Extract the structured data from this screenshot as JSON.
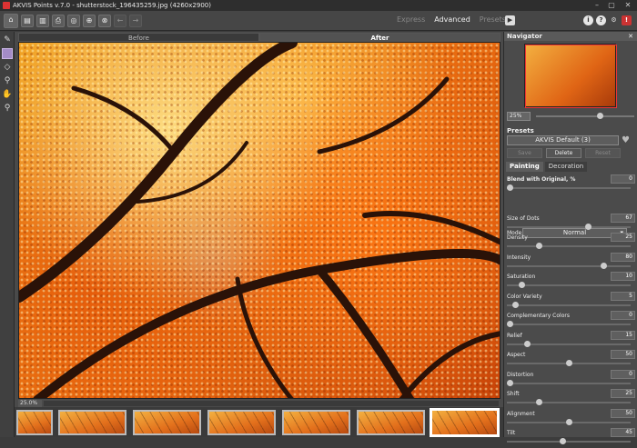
{
  "window": {
    "title": "AKVIS Points v.7.0 - shutterstock_196435259.jpg (4260x2900)"
  },
  "modes": [
    "Express",
    "Advanced",
    "Presets"
  ],
  "active_mode": "Advanced",
  "canvas_tabs": [
    "Before",
    "After"
  ],
  "zoom_label": "25.0%",
  "navigator": {
    "title": "Navigator",
    "zoom": "25%"
  },
  "presets": {
    "label": "Presets",
    "selected": "AKVIS Default (3)",
    "save": "Save",
    "delete": "Delete",
    "reset": "Reset"
  },
  "panel_tabs": [
    "Painting",
    "Decoration"
  ],
  "blend": {
    "label": "Blend with Original, %",
    "value": "0",
    "level": 0
  },
  "mode": {
    "label": "Mode:",
    "value": "Normal"
  },
  "params": [
    {
      "label": "Size of Dots",
      "value": "67",
      "level": 0.67
    },
    {
      "label": "Density",
      "value": "25",
      "level": 0.25
    },
    {
      "label": "Intensity",
      "value": "80",
      "level": 0.8
    },
    {
      "label": "Saturation",
      "value": "10",
      "level": 0.1
    },
    {
      "label": "Color Variety",
      "value": "5",
      "level": 0.05
    },
    {
      "label": "Complementary Colors",
      "value": "0",
      "level": 0
    },
    {
      "label": "Relief",
      "value": "15",
      "level": 0.15
    },
    {
      "label": "Aspect",
      "value": "50",
      "level": 0.5
    },
    {
      "label": "Distortion",
      "value": "0",
      "level": 0
    },
    {
      "label": "Shift",
      "value": "25",
      "level": 0.25
    },
    {
      "label": "Alignment",
      "value": "50",
      "level": 0.5
    },
    {
      "label": "Tilt",
      "value": "45",
      "level": 0.45
    }
  ]
}
